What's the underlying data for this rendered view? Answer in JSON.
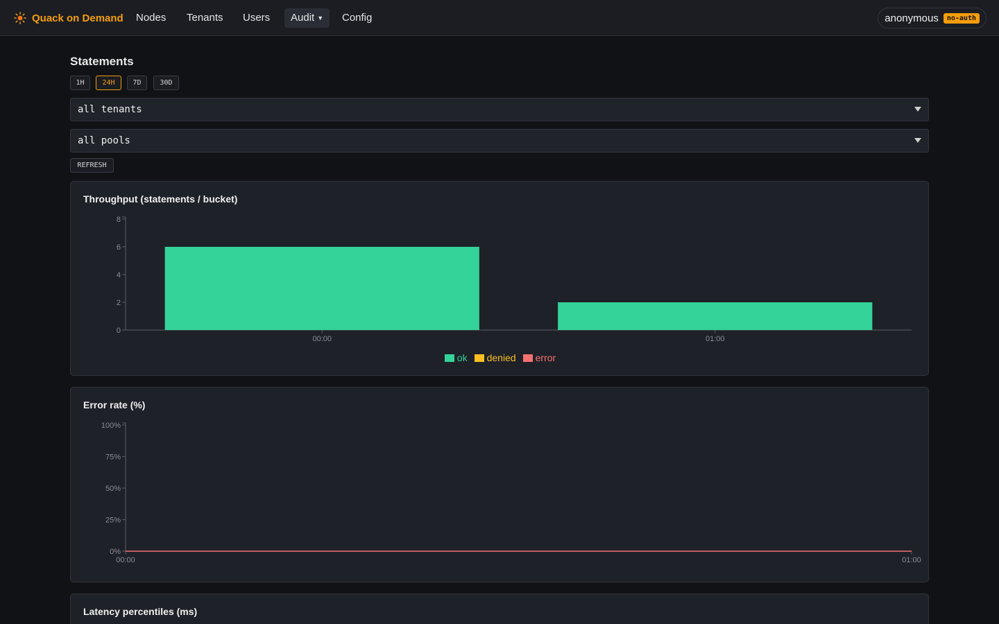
{
  "app": {
    "name": "Quack on Demand"
  },
  "nav": [
    {
      "label": "Nodes"
    },
    {
      "label": "Tenants"
    },
    {
      "label": "Users"
    },
    {
      "label": "Audit",
      "has_dropdown": true,
      "active": true
    },
    {
      "label": "Config"
    }
  ],
  "user": {
    "name": "anonymous",
    "auth_badge": "no-auth"
  },
  "page": {
    "title": "Statements"
  },
  "time_ranges": [
    {
      "label": "1H"
    },
    {
      "label": "24H",
      "active": true
    },
    {
      "label": "7D"
    },
    {
      "label": "30D"
    }
  ],
  "filters": {
    "tenant": {
      "value": "all tenants"
    },
    "pool": {
      "value": "all pools"
    }
  },
  "refresh_label": "REFRESH",
  "colors": {
    "ok": "#34d399",
    "denied": "#fbbf24",
    "error": "#f87171",
    "accent": "#f59e0b"
  },
  "chart_data": [
    {
      "type": "bar",
      "title": "Throughput (statements / bucket)",
      "categories": [
        "00:00",
        "01:00"
      ],
      "series": [
        {
          "name": "ok",
          "values": [
            6,
            2
          ]
        },
        {
          "name": "denied",
          "values": [
            0,
            0
          ]
        },
        {
          "name": "error",
          "values": [
            0,
            0
          ]
        }
      ],
      "stacked": true,
      "yticks": [
        "0",
        "2",
        "4",
        "6",
        "8"
      ],
      "ylim": [
        0,
        8
      ],
      "legend": "bottom-center"
    },
    {
      "type": "line",
      "title": "Error rate (%)",
      "x": [
        "00:00",
        "01:00"
      ],
      "series": [
        {
          "values": [
            0,
            0
          ]
        }
      ],
      "yticks": [
        "0%",
        "25%",
        "50%",
        "75%",
        "100%"
      ],
      "ylim": [
        0,
        100
      ]
    },
    {
      "type": "line",
      "title": "Latency percentiles (ms)"
    }
  ]
}
